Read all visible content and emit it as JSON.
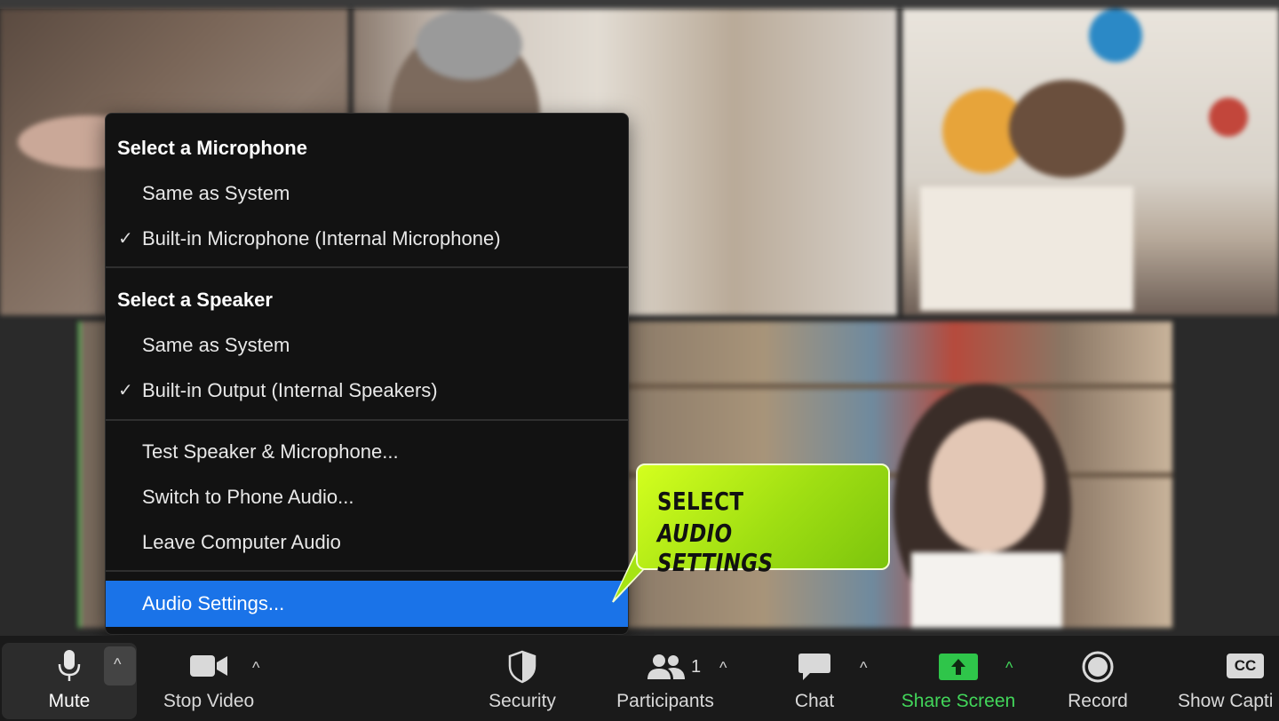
{
  "audio_menu": {
    "microphone_heading": "Select a Microphone",
    "microphone_options": [
      {
        "label": "Same as System",
        "checked": false
      },
      {
        "label": "Built-in Microphone (Internal Microphone)",
        "checked": true
      }
    ],
    "speaker_heading": "Select a Speaker",
    "speaker_options": [
      {
        "label": "Same as System",
        "checked": false
      },
      {
        "label": "Built-in Output (Internal Speakers)",
        "checked": true
      }
    ],
    "actions": [
      {
        "label": "Test Speaker & Microphone..."
      },
      {
        "label": "Switch to Phone Audio..."
      },
      {
        "label": "Leave Computer Audio"
      }
    ],
    "settings": {
      "label": "Audio Settings...",
      "highlighted": true
    },
    "checkmark_glyph": "✓",
    "highlight_color": "#1a73e8"
  },
  "callout": {
    "line1": "SELECT",
    "line2": "AUDIO SETTINGS",
    "color": "#b5f018"
  },
  "toolbar": {
    "mute": {
      "label": "Mute",
      "icon": "microphone-icon"
    },
    "stop_video": {
      "label": "Stop Video",
      "icon": "video-camera-icon"
    },
    "security": {
      "label": "Security",
      "icon": "shield-icon"
    },
    "participants": {
      "label": "Participants",
      "count": "1",
      "icon": "people-icon"
    },
    "chat": {
      "label": "Chat",
      "icon": "chat-bubble-icon"
    },
    "share_screen": {
      "label": "Share Screen",
      "icon": "share-arrow-icon",
      "color": "#42d65a"
    },
    "record": {
      "label": "Record",
      "icon": "record-icon"
    },
    "captions": {
      "label": "Show Capti",
      "icon": "cc-icon",
      "badge": "CC"
    },
    "caret_glyph": "^"
  }
}
